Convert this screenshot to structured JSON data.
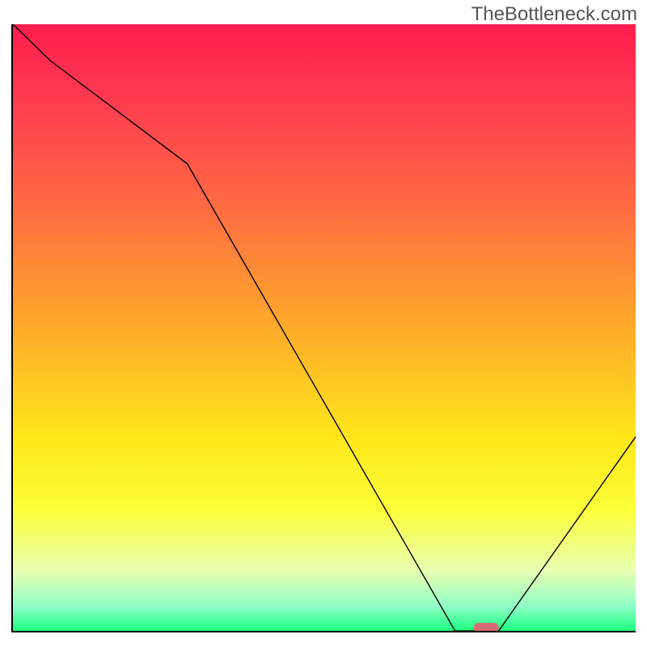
{
  "watermark": "TheBottleneck.com",
  "chart_data": {
    "type": "line",
    "title": "",
    "xlabel": "",
    "ylabel": "",
    "x": [
      0,
      6,
      28,
      71,
      75,
      78,
      100
    ],
    "values": [
      100,
      94,
      77,
      0,
      0,
      0,
      32
    ],
    "xlim": [
      0,
      100
    ],
    "ylim": [
      0,
      100
    ],
    "marker": {
      "x_range": [
        74,
        78
      ],
      "y": 0,
      "color": "#d56b72"
    },
    "background_gradient": [
      {
        "pos": 0,
        "color": "#ff1d4d"
      },
      {
        "pos": 100,
        "color": "#1aff7f"
      }
    ]
  }
}
